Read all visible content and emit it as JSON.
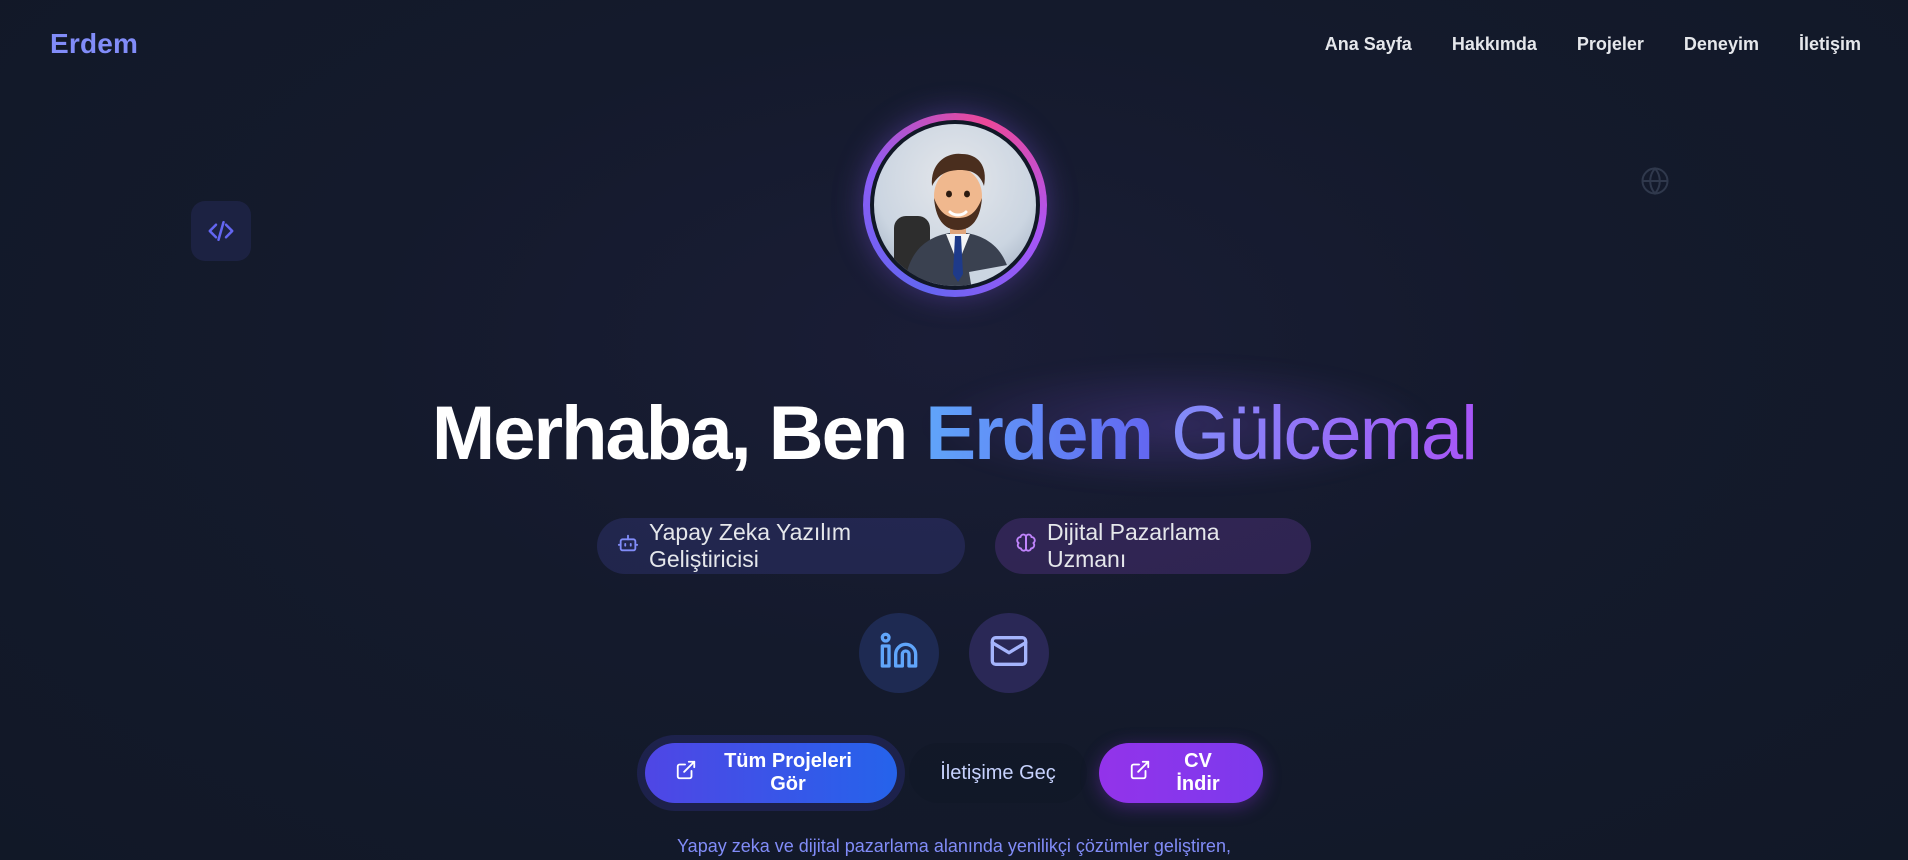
{
  "header": {
    "logo": "Erdem",
    "nav": [
      "Ana Sayfa",
      "Hakkımda",
      "Projeler",
      "Deneyim",
      "İletişim"
    ]
  },
  "hero": {
    "title_part1": "Merhaba, Ben",
    "title_first": "Erdem",
    "title_last": "Gülcemal",
    "badges": [
      {
        "label": "Yapay Zeka Yazılım Geliştiricisi",
        "icon": "robot-icon"
      },
      {
        "label": "Dijital Pazarlama Uzmanı",
        "icon": "brain-icon"
      }
    ],
    "socials": [
      {
        "name": "linkedin",
        "icon": "linkedin-icon"
      },
      {
        "name": "email",
        "icon": "mail-icon"
      }
    ],
    "buttons": {
      "projects": "Tüm Projeleri Gör",
      "contact": "İletişime Geç",
      "cv": "CV İndir"
    },
    "tagline": "Yapay zeka ve dijital pazarlama alanında yenilikçi çözümler geliştiren,"
  },
  "colors": {
    "background": "#111827",
    "accent": "#818cf8",
    "primary_button": "#4f46e5",
    "cv_button": "#9333ea"
  }
}
